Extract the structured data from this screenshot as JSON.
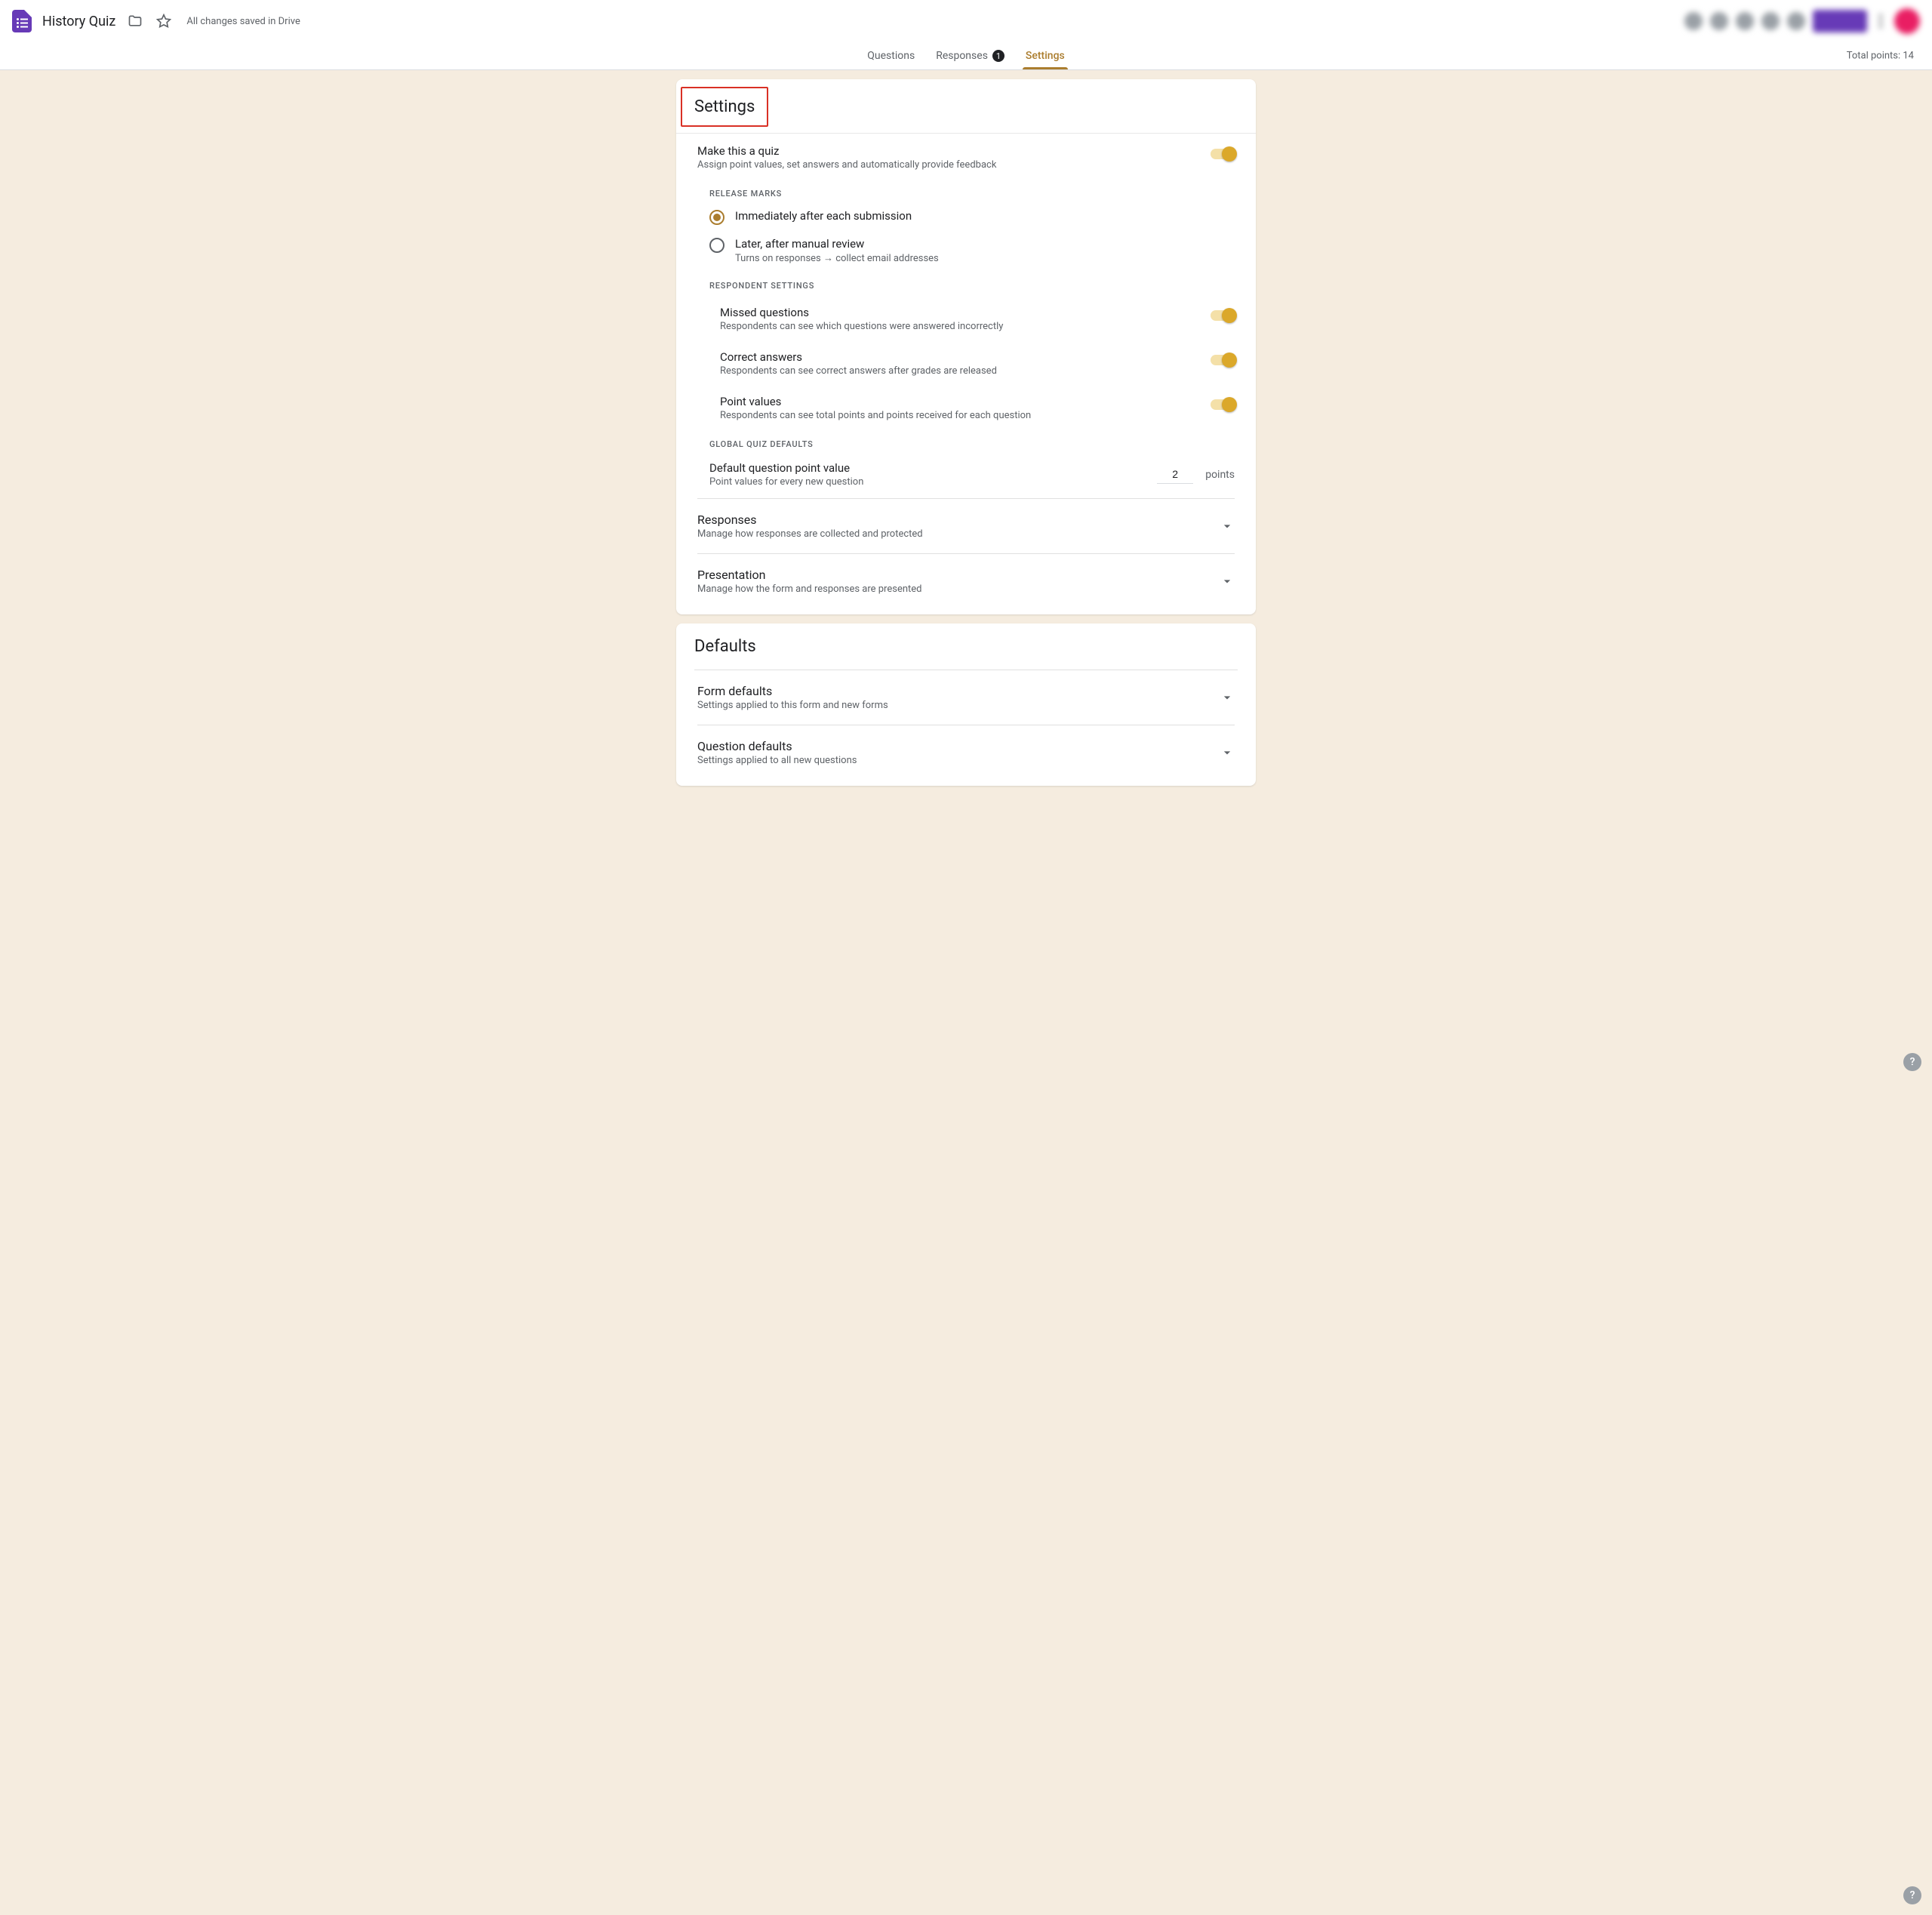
{
  "header": {
    "doc_title": "History Quiz",
    "save_status": "All changes saved in Drive"
  },
  "tabs": {
    "questions": "Questions",
    "responses": "Responses",
    "responses_count": "1",
    "settings": "Settings",
    "total_points": "Total points: 14"
  },
  "settings_card": {
    "title": "Settings",
    "make_quiz": {
      "title": "Make this a quiz",
      "desc": "Assign point values, set answers and automatically provide feedback"
    },
    "release_marks_label": "RELEASE MARKS",
    "release_immediate": "Immediately after each submission",
    "release_manual": "Later, after manual review",
    "release_manual_sub": "Turns on responses → collect email addresses",
    "respondent_label": "RESPONDENT SETTINGS",
    "missed": {
      "title": "Missed questions",
      "desc": "Respondents can see which questions were answered incorrectly"
    },
    "correct": {
      "title": "Correct answers",
      "desc": "Respondents can see correct answers after grades are released"
    },
    "points": {
      "title": "Point values",
      "desc": "Respondents can see total points and points received for each question"
    },
    "global_label": "GLOBAL QUIZ DEFAULTS",
    "default_points": {
      "title": "Default question point value",
      "desc": "Point values for every new question",
      "value": "2",
      "unit": "points"
    },
    "responses_section": {
      "title": "Responses",
      "desc": "Manage how responses are collected and protected"
    },
    "presentation_section": {
      "title": "Presentation",
      "desc": "Manage how the form and responses are presented"
    }
  },
  "defaults_card": {
    "title": "Defaults",
    "form_defaults": {
      "title": "Form defaults",
      "desc": "Settings applied to this form and new forms"
    },
    "question_defaults": {
      "title": "Question defaults",
      "desc": "Settings applied to all new questions"
    }
  },
  "help": "?"
}
